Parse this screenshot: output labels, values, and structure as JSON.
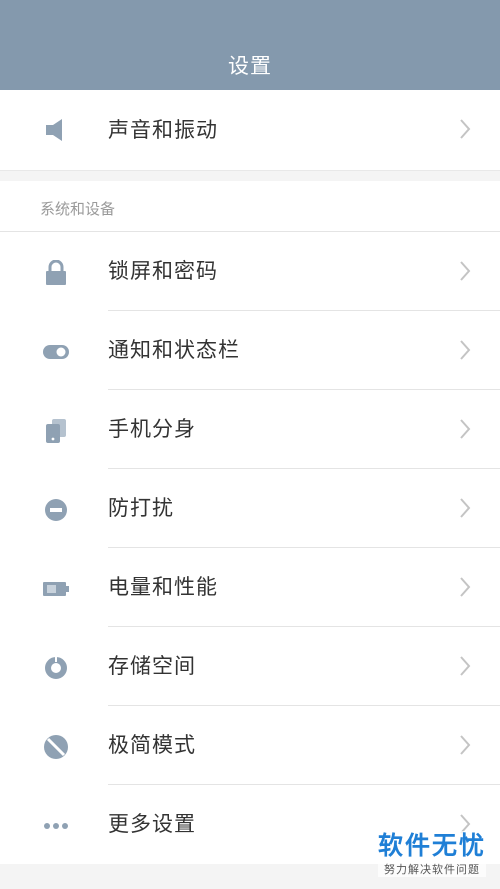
{
  "header": {
    "title": "设置"
  },
  "top_group": {
    "items": [
      {
        "label": "声音和振动",
        "icon": "speaker-icon"
      }
    ]
  },
  "system_section": {
    "title": "系统和设备",
    "items": [
      {
        "label": "锁屏和密码",
        "icon": "lock-icon"
      },
      {
        "label": "通知和状态栏",
        "icon": "toggle-icon"
      },
      {
        "label": "手机分身",
        "icon": "phone-clone-icon"
      },
      {
        "label": "防打扰",
        "icon": "do-not-disturb-icon"
      },
      {
        "label": "电量和性能",
        "icon": "battery-icon"
      },
      {
        "label": "存储空间",
        "icon": "storage-icon"
      },
      {
        "label": "极简模式",
        "icon": "simple-mode-icon"
      },
      {
        "label": "更多设置",
        "icon": "more-dots-icon"
      }
    ]
  },
  "watermark": {
    "title": "软件无忧",
    "subtitle": "努力解决软件问题"
  },
  "colors": {
    "header_bg": "#8499ad",
    "icon": "#8fa1b3",
    "chevron": "#c4c4c4"
  }
}
